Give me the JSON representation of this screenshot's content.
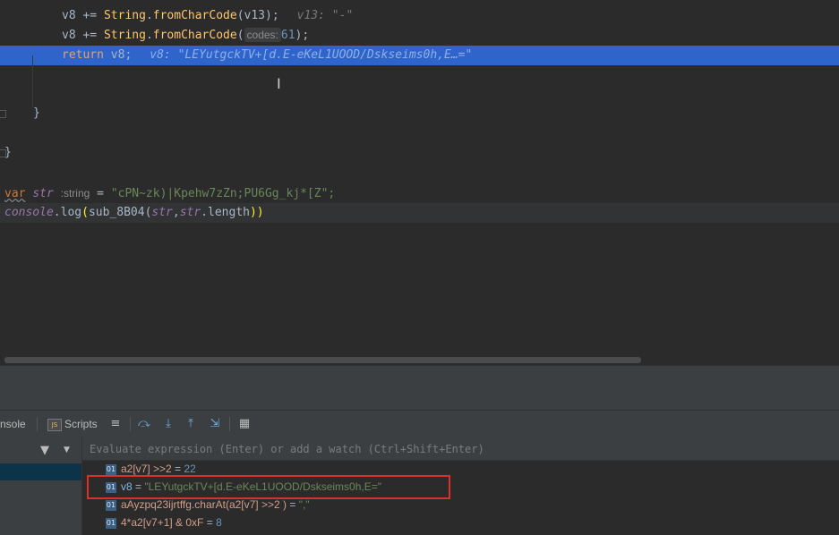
{
  "code": {
    "line1": {
      "lhs": "v8 += ",
      "cls": "String",
      "dot": ".",
      "method": "fromCharCode",
      "args": "(v13);",
      "hint": "v13: \"-\""
    },
    "line2": {
      "lhs": "v8 += ",
      "cls": "String",
      "dot": ".",
      "method": "fromCharCode",
      "open": "(",
      "param_hint": "codes:",
      "arg": "61",
      "close": ");"
    },
    "line3": {
      "keyword": "return",
      "value": " v8;",
      "hint": "v8: \"LEYutgckTV+[d.E-eKeL1UOOD/Dskseims0h,E…=\""
    },
    "brace_inner": "}",
    "brace_outer": "}",
    "line_var": {
      "keyword": "var",
      "name": "str",
      "type_hint": ":string",
      "eq": " = ",
      "value": "\"cPN~zk)|Kpehw7zZn;PU6Gg_kj*[Z\";"
    },
    "line_log": {
      "obj": "console",
      "method": ".log",
      "open": "(",
      "fn": "sub_8B04",
      "args_open": "(",
      "arg1": "str",
      "comma": ",",
      "arg2": "str",
      "prop": ".length",
      "close": "))"
    }
  },
  "debugger": {
    "tabs": {
      "console": "nsole",
      "scripts": "Scripts"
    },
    "tab_icon": "JS",
    "watch_placeholder": "Evaluate expression (Enter) or add a watch (Ctrl+Shift+Enter)",
    "watches": [
      {
        "icon": "01",
        "name": "a2[v7] >>2",
        "eq": " = ",
        "value": "22"
      },
      {
        "icon": "01",
        "name": "v8",
        "eq": " = ",
        "value": "\"LEYutgckTV+[d.E-eKeL1UOOD/Dskseims0h,E=\""
      },
      {
        "icon": "01",
        "name": "aAyzpq23ijrtffg.charAt(a2[v7] >>2 )",
        "eq": " = ",
        "value": "\",\""
      },
      {
        "icon": "01",
        "name": "4*a2[v7+1] & 0xF",
        "eq": " = ",
        "value": "8"
      }
    ]
  },
  "colors": {
    "editor_bg": "#2b2b2b",
    "execution_line": "#2f65ca",
    "keyword": "#cc7832",
    "method": "#ffc66d",
    "number": "#6897bb",
    "string": "#6a8759",
    "highlight_box": "#d9302a"
  },
  "icons": {
    "fold_markers": "fold-marker",
    "text_cursor": "i-beam-cursor",
    "toolbar": [
      "scripts-icon",
      "menu-icon",
      "step-over-icon",
      "step-into-icon",
      "step-out-icon",
      "run-to-cursor-icon",
      "table-icon"
    ],
    "filter": "filter-icon",
    "watch_item": "primitive-value-icon"
  }
}
